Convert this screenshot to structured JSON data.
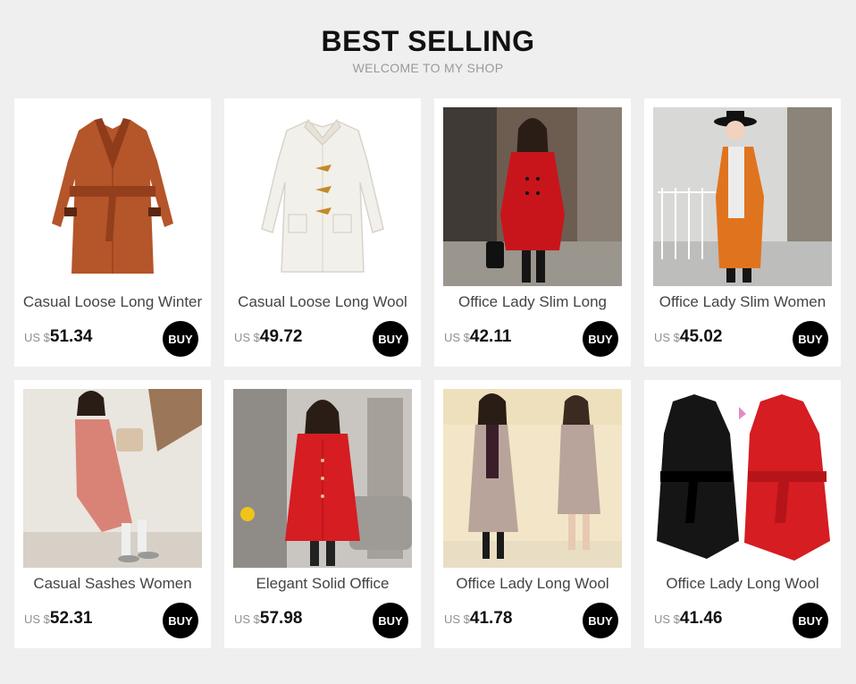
{
  "header": {
    "title": "BEST SELLING",
    "subtitle": "WELCOME TO MY SHOP"
  },
  "products": [
    {
      "name": "Casual Loose Long Winter",
      "currency": "US $",
      "price": "51.34",
      "buy_label": "BUY",
      "image": "rust-coat-product-photo",
      "color": "#b4552a"
    },
    {
      "name": "Casual Loose Long Wool",
      "currency": "US $",
      "price": "49.72",
      "buy_label": "BUY",
      "image": "white-toggle-coat-product-photo",
      "color": "#f2f0ea"
    },
    {
      "name": "Office Lady Slim Long",
      "currency": "US $",
      "price": "42.11",
      "buy_label": "BUY",
      "image": "red-coat-model-photo",
      "color": "#c8151c"
    },
    {
      "name": "Office Lady Slim Women",
      "currency": "US $",
      "price": "45.02",
      "buy_label": "BUY",
      "image": "orange-coat-model-photo",
      "color": "#e0741e"
    },
    {
      "name": "Casual Sashes Women",
      "currency": "US $",
      "price": "52.31",
      "buy_label": "BUY",
      "image": "pink-coat-model-photo",
      "color": "#d98376"
    },
    {
      "name": "Elegant Solid Office",
      "currency": "US $",
      "price": "57.98",
      "buy_label": "BUY",
      "image": "red-coat-indoor-model-photo",
      "color": "#d51d22"
    },
    {
      "name": "Office Lady Long Wool",
      "currency": "US $",
      "price": "41.78",
      "buy_label": "BUY",
      "image": "beige-coat-model-photo",
      "color": "#b9a49b"
    },
    {
      "name": "Office Lady Long Wool",
      "currency": "US $",
      "price": "41.46",
      "buy_label": "BUY",
      "image": "black-red-belted-coats-photo",
      "color": "#cf1f1f"
    }
  ]
}
